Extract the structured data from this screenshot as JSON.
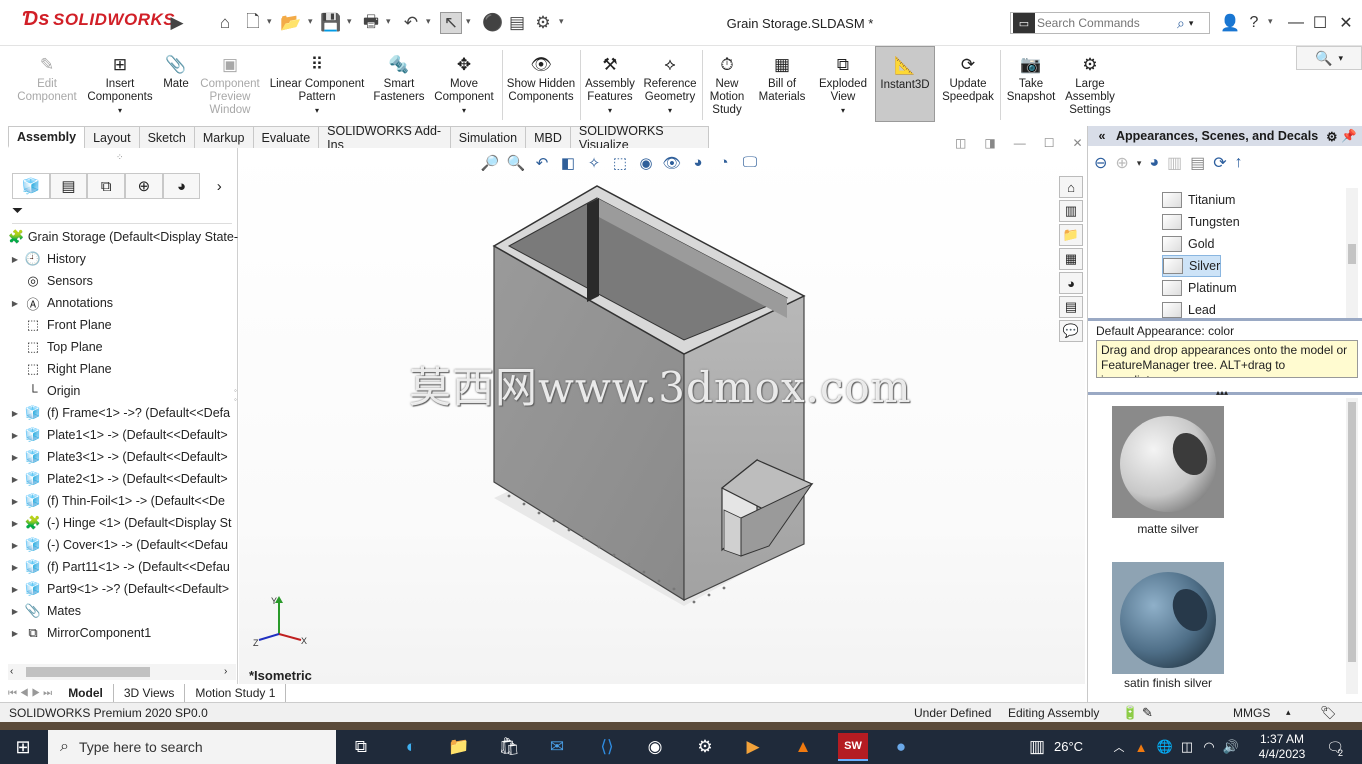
{
  "titlebar": {
    "app_logo": "SOLIDWORKS",
    "document_title": "Grain Storage.SLDASM *",
    "search_placeholder": "Search Commands"
  },
  "commands": [
    {
      "label": "Edit Component",
      "state": "disabled"
    },
    {
      "label": "Insert Components",
      "state": "normal"
    },
    {
      "label": "Mate",
      "state": "normal"
    },
    {
      "label": "Component Preview Window",
      "state": "disabled"
    },
    {
      "label": "Linear Component Pattern",
      "state": "normal"
    },
    {
      "label": "Smart Fasteners",
      "state": "normal"
    },
    {
      "label": "Move Component",
      "state": "normal"
    },
    {
      "label": "Show Hidden Components",
      "state": "normal"
    },
    {
      "label": "Assembly Features",
      "state": "normal"
    },
    {
      "label": "Reference Geometry",
      "state": "normal"
    },
    {
      "label": "New Motion Study",
      "state": "normal"
    },
    {
      "label": "Bill of Materials",
      "state": "normal"
    },
    {
      "label": "Exploded View",
      "state": "normal"
    },
    {
      "label": "Instant3D",
      "state": "active"
    },
    {
      "label": "Update Speedpak",
      "state": "normal"
    },
    {
      "label": "Take Snapshot",
      "state": "normal"
    },
    {
      "label": "Large Assembly Settings",
      "state": "normal"
    }
  ],
  "tabs": [
    "Assembly",
    "Layout",
    "Sketch",
    "Markup",
    "Evaluate",
    "SOLIDWORKS Add-Ins",
    "Simulation",
    "MBD",
    "SOLIDWORKS Visualize"
  ],
  "feature_tree": {
    "root": "Grain Storage  (Default<Display State-",
    "items": [
      {
        "label": "History",
        "expandable": true,
        "icon": "history-icon"
      },
      {
        "label": "Sensors",
        "expandable": false,
        "icon": "sensor-icon"
      },
      {
        "label": "Annotations",
        "expandable": true,
        "icon": "annotations-icon"
      },
      {
        "label": "Front Plane",
        "expandable": false,
        "icon": "plane-icon"
      },
      {
        "label": "Top Plane",
        "expandable": false,
        "icon": "plane-icon"
      },
      {
        "label": "Right Plane",
        "expandable": false,
        "icon": "plane-icon"
      },
      {
        "label": "Origin",
        "expandable": false,
        "icon": "origin-icon"
      },
      {
        "label": "(f) Frame<1> ->? (Default<<Defa",
        "expandable": true,
        "icon": "part-icon"
      },
      {
        "label": "Plate1<1> -> (Default<<Default>",
        "expandable": true,
        "icon": "part-icon"
      },
      {
        "label": "Plate3<1> -> (Default<<Default>",
        "expandable": true,
        "icon": "part-icon"
      },
      {
        "label": "Plate2<1> -> (Default<<Default>",
        "expandable": true,
        "icon": "part-icon"
      },
      {
        "label": "(f) Thin-Foil<1> -> (Default<<De",
        "expandable": true,
        "icon": "part-icon"
      },
      {
        "label": "(-) Hinge <1> (Default<Display St",
        "expandable": true,
        "icon": "assembly-icon"
      },
      {
        "label": "(-) Cover<1> -> (Default<<Defau",
        "expandable": true,
        "icon": "part-icon"
      },
      {
        "label": "(f) Part11<1> -> (Default<<Defau",
        "expandable": true,
        "icon": "part-icon"
      },
      {
        "label": "Part9<1> ->? (Default<<Default>",
        "expandable": true,
        "icon": "part-icon"
      },
      {
        "label": "Mates",
        "expandable": true,
        "icon": "mates-icon"
      },
      {
        "label": "MirrorComponent1",
        "expandable": true,
        "icon": "mirror-icon"
      }
    ]
  },
  "bottom_tabs": [
    "Model",
    "3D Views",
    "Motion Study 1"
  ],
  "viewport": {
    "watermark": "莫西网www.3dmox.com",
    "view_label": "*Isometric",
    "triad": {
      "x": "X",
      "y": "Y",
      "z": "Z"
    }
  },
  "task_pane": {
    "title": "Appearances, Scenes, and Decals",
    "appearance_list": [
      {
        "label": "Titanium",
        "selected": false
      },
      {
        "label": "Tungsten",
        "selected": false
      },
      {
        "label": "Gold",
        "selected": false
      },
      {
        "label": "Silver",
        "selected": true
      },
      {
        "label": "Platinum",
        "selected": false
      },
      {
        "label": "Lead",
        "selected": false
      }
    ],
    "default_appearance": "Default Appearance: color",
    "tooltip": "Drag and drop appearances onto the model or FeatureManager tree.  ALT+drag to immediate...",
    "swatches": [
      {
        "label": "matte silver",
        "color": "#c8c8c8"
      },
      {
        "label": "satin finish silver",
        "color": "#4f6f88"
      }
    ]
  },
  "statusbar": {
    "product": "SOLIDWORKS Premium 2020 SP0.0",
    "definition": "Under Defined",
    "mode": "Editing Assembly",
    "units": "MMGS"
  },
  "taskbar": {
    "search_placeholder": "Type here to search",
    "temperature": "26°C",
    "time": "1:37 AM",
    "date": "4/4/2023",
    "notification_count": "2"
  }
}
